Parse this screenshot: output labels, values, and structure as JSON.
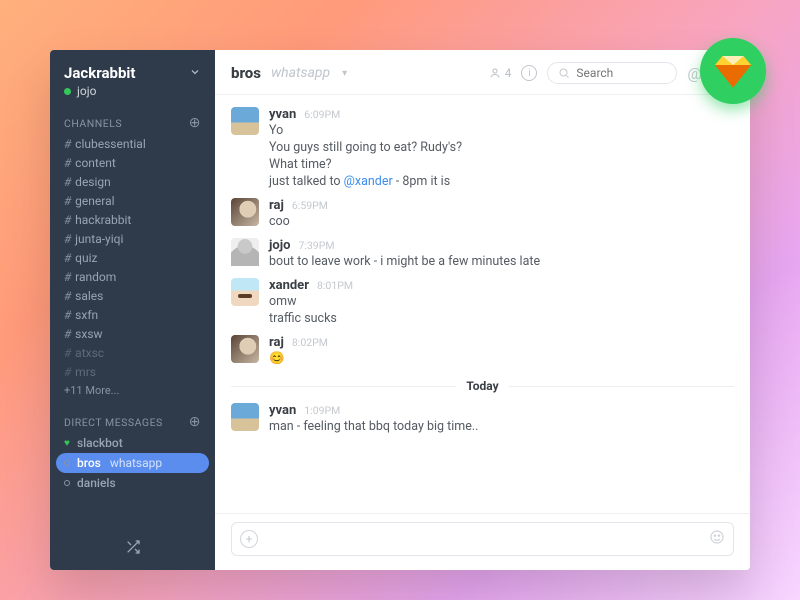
{
  "team": {
    "name": "Jackrabbit",
    "user": "jojo"
  },
  "sidebar": {
    "channels_header": "CHANNELS",
    "dm_header": "DIRECT MESSAGES",
    "channels": [
      {
        "name": "clubessential",
        "dim": false
      },
      {
        "name": "content",
        "dim": false
      },
      {
        "name": "design",
        "dim": false
      },
      {
        "name": "general",
        "dim": false
      },
      {
        "name": "hackrabbit",
        "dim": false
      },
      {
        "name": "junta-yiqi",
        "dim": false
      },
      {
        "name": "quiz",
        "dim": false
      },
      {
        "name": "random",
        "dim": false
      },
      {
        "name": "sales",
        "dim": false
      },
      {
        "name": "sxfn",
        "dim": false
      },
      {
        "name": "sxsw",
        "dim": false
      },
      {
        "name": "atxsc",
        "dim": true
      },
      {
        "name": "mrs",
        "dim": true
      }
    ],
    "more": "+11 More...",
    "dms": [
      {
        "name": "slackbot",
        "presence": "heart"
      },
      {
        "name": "bros",
        "sub": "whatsapp",
        "presence": "open",
        "active": true
      },
      {
        "name": "daniels",
        "presence": "open"
      }
    ]
  },
  "header": {
    "channel": "bros",
    "subtitle": "whatsapp",
    "members_label": "4",
    "search_placeholder": "Search"
  },
  "divider_label": "Today",
  "messages": [
    {
      "user": "yvan",
      "avatar": "yvan",
      "time": "6:09PM",
      "lines": [
        "Yo",
        "You guys still going to eat? Rudy's?",
        "What time?",
        "just talked to @xander - 8pm it is"
      ]
    },
    {
      "user": "raj",
      "avatar": "raj",
      "time": "6:59PM",
      "lines": [
        "coo"
      ]
    },
    {
      "user": "jojo",
      "avatar": "jojo",
      "time": "7:39PM",
      "lines": [
        "bout to leave work - i might be a few minutes late"
      ]
    },
    {
      "user": "xander",
      "avatar": "xander",
      "time": "8:01PM",
      "lines": [
        "omw",
        "traffic sucks"
      ]
    },
    {
      "user": "raj",
      "avatar": "raj",
      "time": "8:02PM",
      "lines": [
        "😊"
      ]
    }
  ],
  "today_messages": [
    {
      "user": "yvan",
      "avatar": "yvan",
      "time": "1:09PM",
      "lines": [
        "man - feeling that bbq today big time.."
      ]
    }
  ]
}
